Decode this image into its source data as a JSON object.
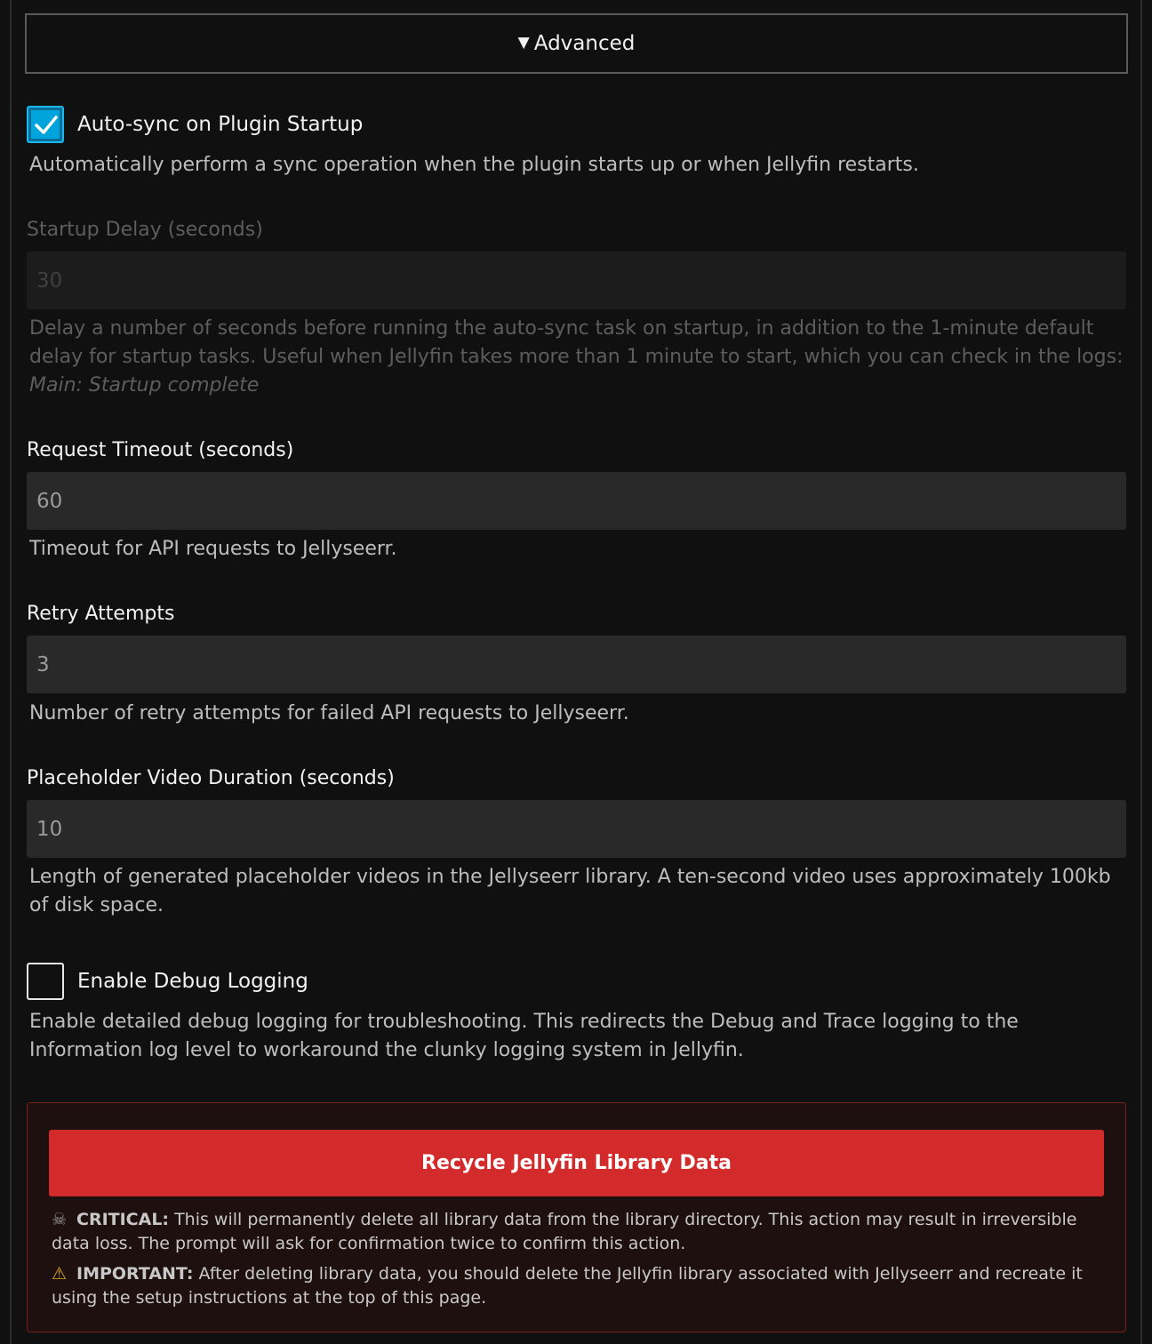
{
  "advanced": {
    "summary_label": "Advanced",
    "triangle": "▼"
  },
  "auto_sync": {
    "label": "Auto-sync on Plugin Startup",
    "checked": true,
    "description": "Automatically perform a sync operation when the plugin starts up or when Jellyfin restarts."
  },
  "startup_delay": {
    "label": "Startup Delay (seconds)",
    "value": "30",
    "description": "Delay a number of seconds before running the auto-sync task on startup, in addition to the 1-minute default delay for startup tasks. Useful when Jellyfin takes more than 1 minute to start, which you can check in the logs:",
    "log_message": "Main: Startup complete"
  },
  "request_timeout": {
    "label": "Request Timeout (seconds)",
    "value": "60",
    "description": "Timeout for API requests to Jellyseerr."
  },
  "retry_attempts": {
    "label": "Retry Attempts",
    "value": "3",
    "description": "Number of retry attempts for failed API requests to Jellyseerr."
  },
  "placeholder_duration": {
    "label": "Placeholder Video Duration (seconds)",
    "value": "10",
    "description": "Length of generated placeholder videos in the Jellyseerr library. A ten-second video uses approximately 100kb of disk space."
  },
  "debug_logging": {
    "label": "Enable Debug Logging",
    "checked": false,
    "description": "Enable detailed debug logging for troubleshooting. This redirects the Debug and Trace logging to the Information log level to workaround the clunky logging system in Jellyfin."
  },
  "danger_zone": {
    "button_label": "Recycle Jellyfin Library Data",
    "critical_icon": "☠",
    "critical_title": "CRITICAL:",
    "critical_text": " This will permanently delete all library data from the library directory. This action may result in irreversible data loss. The prompt will ask for confirmation twice to confirm this action.",
    "important_icon": "⚠",
    "important_title": "IMPORTANT:",
    "important_text": " After deleting library data, you should delete the Jellyfin library associated with Jellyseerr and recreate it using the setup instructions at the top of this page."
  },
  "colors": {
    "accent": "#00a4dc",
    "danger": "#d32b2b",
    "background": "#101010",
    "input_bg": "#292929"
  }
}
